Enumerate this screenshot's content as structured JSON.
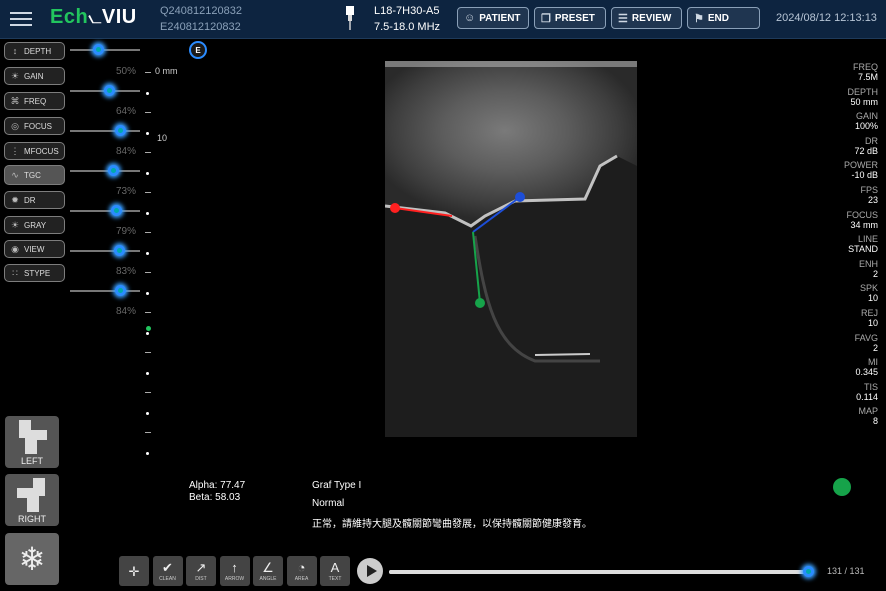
{
  "topbar": {
    "logo_prefix": "Ech",
    "logo_suffix": "VIU",
    "id1": "Q240812120832",
    "id2": "E240812120832",
    "probe_model": "L18-7H30-A5",
    "probe_freq": "7.5-18.0 MHz",
    "buttons": {
      "patient": "PATIENT",
      "preset": "PRESET",
      "review": "REVIEW",
      "end": "END"
    },
    "datetime": "2024/08/12 12:13:13"
  },
  "left_panel": {
    "buttons": [
      "DEPTH",
      "GAIN",
      "FREQ",
      "FOCUS",
      "MFOCUS",
      "TGC",
      "DR",
      "GRAY",
      "VIEW",
      "STYPE"
    ],
    "percents": [
      "50%",
      "64%",
      "84%",
      "73%",
      "79%",
      "83%",
      "84%"
    ],
    "slider_levels": [
      0.4,
      0.55,
      0.72,
      0.62,
      0.66,
      0.7,
      0.72
    ]
  },
  "depth_scale": {
    "zero": "0 mm",
    "ten": "10"
  },
  "body_markers": {
    "left": "LEFT",
    "right": "RIGHT"
  },
  "image_badge": "E",
  "params": [
    {
      "k": "FREQ",
      "v": "7.5M"
    },
    {
      "k": "DEPTH",
      "v": "50 mm"
    },
    {
      "k": "GAIN",
      "v": "100%"
    },
    {
      "k": "DR",
      "v": "72 dB"
    },
    {
      "k": "POWER",
      "v": "-10 dB"
    },
    {
      "k": "FPS",
      "v": "23"
    },
    {
      "k": "FOCUS",
      "v": "34 mm"
    },
    {
      "k": "LINE",
      "v": "STAND"
    },
    {
      "k": "ENH",
      "v": "2"
    },
    {
      "k": "SPK",
      "v": "10"
    },
    {
      "k": "REJ",
      "v": "10"
    },
    {
      "k": "FAVG",
      "v": "2"
    },
    {
      "k": "MI",
      "v": "0.345"
    },
    {
      "k": "TIS",
      "v": "0.114"
    },
    {
      "k": "MAP",
      "v": "8"
    }
  ],
  "measurement": {
    "alpha": "Alpha: 77.47",
    "beta": "Beta: 58.03",
    "graf_type": "Graf Type I",
    "status": "Normal",
    "advice": "正常，請維持大腿及髖關節彎曲發展，以保持髖關節健康發育。"
  },
  "colors": {
    "accent": "#2b8cff",
    "logo_green": "#22c55e",
    "indicator": "#16a34a",
    "line_red": "#ff2020",
    "line_blue": "#1d4ed8",
    "line_green": "#16a34a"
  },
  "toolbar": {
    "tools": [
      {
        "name": "cross",
        "label": ""
      },
      {
        "name": "clean",
        "label": "CLEAN"
      },
      {
        "name": "dist",
        "label": "DIST"
      },
      {
        "name": "arrow",
        "label": "ARROW"
      },
      {
        "name": "angle",
        "label": "ANGLE"
      },
      {
        "name": "area",
        "label": "AREA"
      },
      {
        "name": "text",
        "label": "TEXT"
      }
    ],
    "frame_counter": "131 / 131",
    "progress": 1.0
  }
}
